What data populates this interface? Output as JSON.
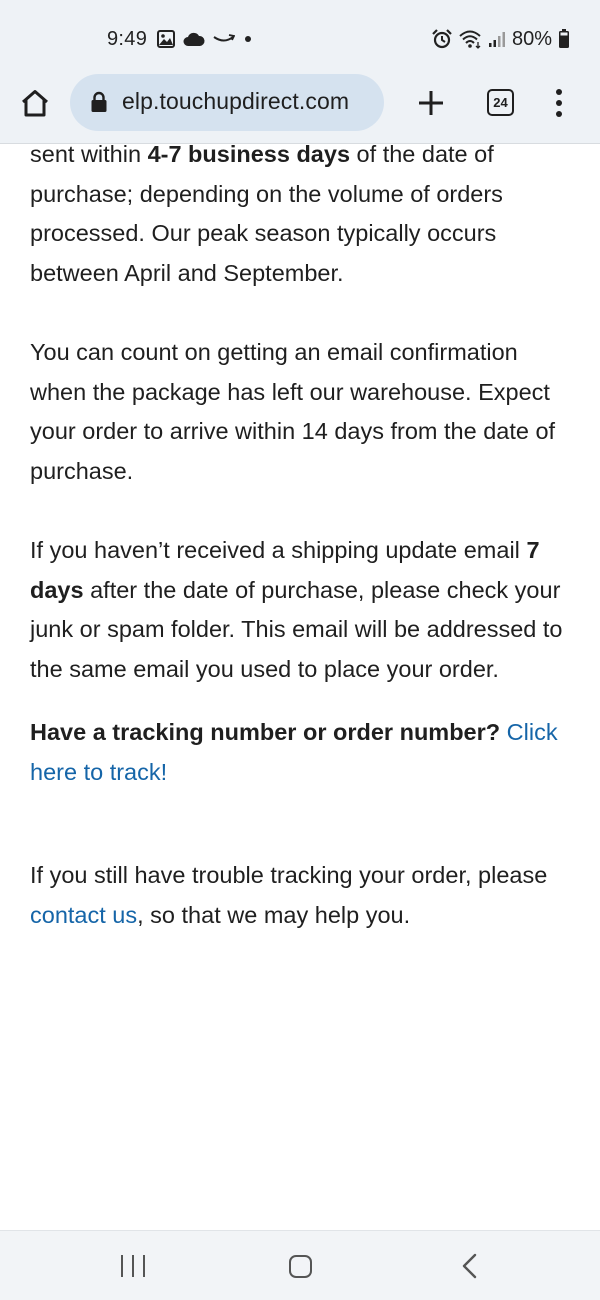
{
  "status_bar": {
    "time": "9:49",
    "battery": "80%",
    "left_icons": [
      "gallery-icon",
      "cloud-icon",
      "amazon-smile-icon",
      "dot-icon"
    ],
    "right_icons": [
      "alarm-icon",
      "wifi-icon",
      "signal-icon",
      "battery-icon"
    ]
  },
  "browser": {
    "url": "elp.touchupdirect.com",
    "tab_count": "24"
  },
  "content": {
    "p1": {
      "t1": "sent within ",
      "b1": "4-7 business days",
      "t2": " of the date of purchase; depending on the volume of orders processed. Our peak season typically occurs between April and September."
    },
    "p2": "You can count on getting an email confirmation when the package has left our warehouse. Expect your order to arrive within 14 days from the date of purchase.",
    "p3": {
      "t1": "If you haven’t received a shipping update email ",
      "b1": "7 days",
      "t2": " after the date of purchase, please check your junk or spam folder. This email will be addressed to the same email you used to place your order."
    },
    "tracking": {
      "question": "Have a tracking number or order number?",
      "link": "Click here to track!"
    },
    "p4": {
      "t1": "If you still have trouble tracking your order, please ",
      "link": "contact us",
      "t2": ", so that we may help you."
    }
  },
  "colors": {
    "link": "#1565a8",
    "url_pill": "#d5e2ef",
    "toolbar_bg": "#eef2f6"
  }
}
